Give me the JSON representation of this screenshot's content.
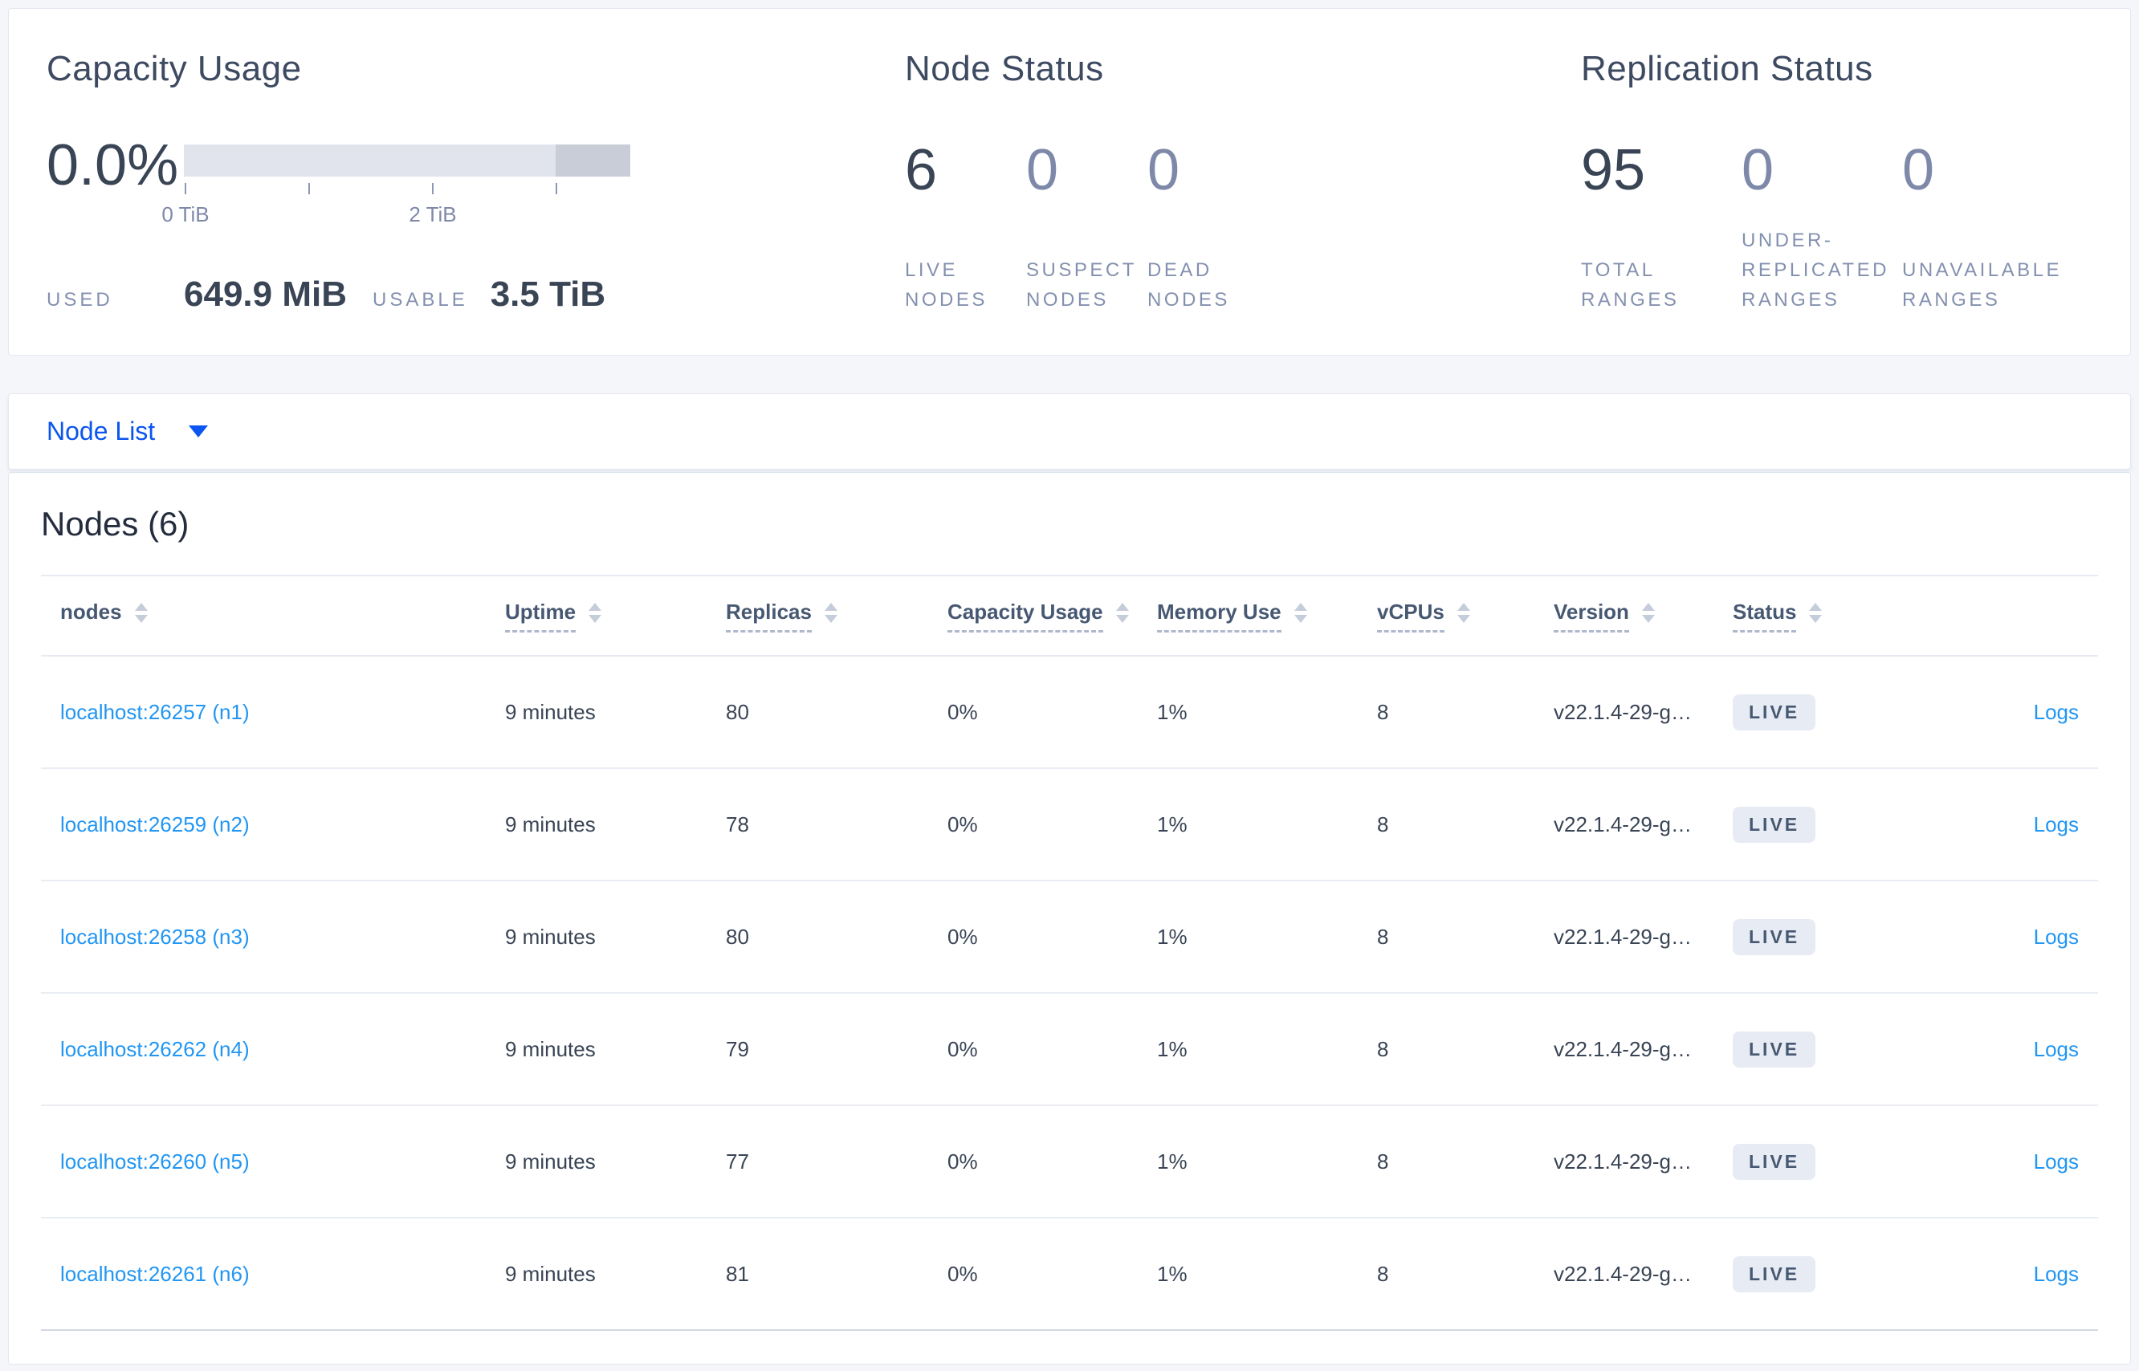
{
  "colors": {
    "accent_link": "#2196f3",
    "selector_blue": "#0b55f0",
    "text_dark": "#394455",
    "text_muted": "#7e89a9",
    "badge_bg": "#e7ebf3",
    "bar_track": "#e2e4ed",
    "bar_reserved": "#c9cdd8"
  },
  "summary": {
    "capacity": {
      "title": "Capacity Usage",
      "percent": "0.0%",
      "axis": {
        "tick0": "0 TiB",
        "tick2": "2 TiB"
      },
      "used_label": "USED",
      "used_value": "649.9 MiB",
      "usable_label": "USABLE",
      "usable_value": "3.5 TiB"
    },
    "node_status": {
      "title": "Node Status",
      "stats": [
        {
          "value": "6",
          "label": "LIVE NODES",
          "muted": false
        },
        {
          "value": "0",
          "label": "SUSPECT NODES",
          "muted": true
        },
        {
          "value": "0",
          "label": "DEAD NODES",
          "muted": true
        }
      ]
    },
    "replication": {
      "title": "Replication Status",
      "stats": [
        {
          "value": "95",
          "label": "TOTAL RANGES",
          "muted": false
        },
        {
          "value": "0",
          "label": "UNDER-REPLICATED RANGES",
          "muted": true
        },
        {
          "value": "0",
          "label": "UNAVAILABLE RANGES",
          "muted": true
        }
      ]
    }
  },
  "view_selector": {
    "label": "Node List"
  },
  "nodes_section": {
    "title": "Nodes (6)",
    "columns": [
      {
        "label": "nodes",
        "dashed": false,
        "sort": true
      },
      {
        "label": "Uptime",
        "dashed": true,
        "sort": true
      },
      {
        "label": "Replicas",
        "dashed": true,
        "sort": true
      },
      {
        "label": "Capacity Usage",
        "dashed": true,
        "sort": true
      },
      {
        "label": "Memory Use",
        "dashed": true,
        "sort": true
      },
      {
        "label": "vCPUs",
        "dashed": true,
        "sort": true
      },
      {
        "label": "Version",
        "dashed": true,
        "sort": true
      },
      {
        "label": "Status",
        "dashed": true,
        "sort": true
      },
      {
        "label": "",
        "dashed": false,
        "sort": false
      }
    ],
    "rows": [
      {
        "node": "localhost:26257 (n1)",
        "uptime": "9 minutes",
        "replicas": "80",
        "capacity": "0%",
        "memory": "1%",
        "vcpus": "8",
        "version": "v22.1.4-29-g…",
        "status": "LIVE",
        "logs": "Logs"
      },
      {
        "node": "localhost:26259 (n2)",
        "uptime": "9 minutes",
        "replicas": "78",
        "capacity": "0%",
        "memory": "1%",
        "vcpus": "8",
        "version": "v22.1.4-29-g…",
        "status": "LIVE",
        "logs": "Logs"
      },
      {
        "node": "localhost:26258 (n3)",
        "uptime": "9 minutes",
        "replicas": "80",
        "capacity": "0%",
        "memory": "1%",
        "vcpus": "8",
        "version": "v22.1.4-29-g…",
        "status": "LIVE",
        "logs": "Logs"
      },
      {
        "node": "localhost:26262 (n4)",
        "uptime": "9 minutes",
        "replicas": "79",
        "capacity": "0%",
        "memory": "1%",
        "vcpus": "8",
        "version": "v22.1.4-29-g…",
        "status": "LIVE",
        "logs": "Logs"
      },
      {
        "node": "localhost:26260 (n5)",
        "uptime": "9 minutes",
        "replicas": "77",
        "capacity": "0%",
        "memory": "1%",
        "vcpus": "8",
        "version": "v22.1.4-29-g…",
        "status": "LIVE",
        "logs": "Logs"
      },
      {
        "node": "localhost:26261 (n6)",
        "uptime": "9 minutes",
        "replicas": "81",
        "capacity": "0%",
        "memory": "1%",
        "vcpus": "8",
        "version": "v22.1.4-29-g…",
        "status": "LIVE",
        "logs": "Logs"
      }
    ]
  }
}
